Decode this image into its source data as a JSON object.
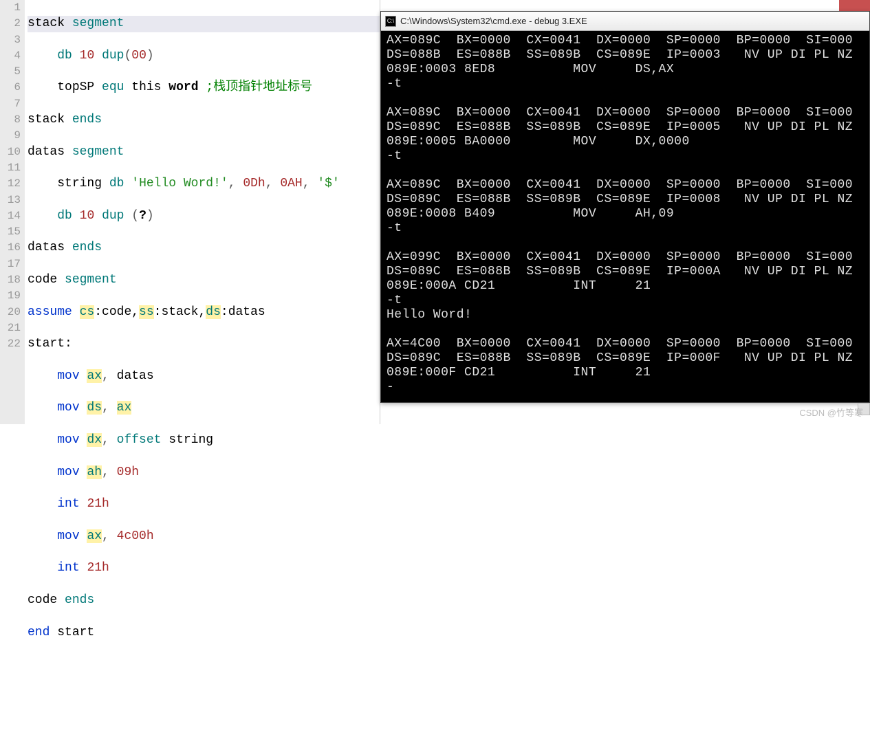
{
  "editor": {
    "line_numbers": [
      "1",
      "2",
      "3",
      "4",
      "5",
      "6",
      "7",
      "8",
      "9",
      "10",
      "11",
      "12",
      "13",
      "14",
      "15",
      "16",
      "17",
      "18",
      "19",
      "20",
      "21",
      "22"
    ],
    "tokens": {
      "stack": "stack",
      "segment": "segment",
      "db": "db",
      "ten": "10",
      "dup": "dup",
      "zero2": "00",
      "topSP": "topSP",
      "equ": "equ",
      "this": "this",
      "word": "word",
      "cmt1": ";栈顶指针地址标号",
      "ends": "ends",
      "datas": "datas",
      "string": "string",
      "hello": "'Hello Word!'",
      "odh": "0Dh",
      "oah": "0AH",
      "dollar": "'$'",
      "qmark": "?",
      "code": "code",
      "assume": "assume",
      "cs": "cs",
      "codel": ":code,",
      "ss": "ss",
      "stackl": ":stack,",
      "ds": "ds",
      "datasl": ":datas",
      "start": "start:",
      "mov": "mov",
      "ax": "ax",
      "dx": "dx",
      "ah": "ah",
      "offset": "offset",
      "int": "int",
      "h21": "21h",
      "h09": "09h",
      "h4c00": "4c00h",
      "end": "end",
      "startw": "start",
      "comma": ", "
    }
  },
  "console": {
    "title": "C:\\Windows\\System32\\cmd.exe - debug  3.EXE",
    "lines": [
      "AX=089C  BX=0000  CX=0041  DX=0000  SP=0000  BP=0000  SI=000",
      "DS=088B  ES=088B  SS=089B  CS=089E  IP=0003   NV UP DI PL NZ",
      "089E:0003 8ED8          MOV     DS,AX",
      "-t",
      "",
      "AX=089C  BX=0000  CX=0041  DX=0000  SP=0000  BP=0000  SI=000",
      "DS=089C  ES=088B  SS=089B  CS=089E  IP=0005   NV UP DI PL NZ",
      "089E:0005 BA0000        MOV     DX,0000",
      "-t",
      "",
      "AX=089C  BX=0000  CX=0041  DX=0000  SP=0000  BP=0000  SI=000",
      "DS=089C  ES=088B  SS=089B  CS=089E  IP=0008   NV UP DI PL NZ",
      "089E:0008 B409          MOV     AH,09",
      "-t",
      "",
      "AX=099C  BX=0000  CX=0041  DX=0000  SP=0000  BP=0000  SI=000",
      "DS=089C  ES=088B  SS=089B  CS=089E  IP=000A   NV UP DI PL NZ",
      "089E:000A CD21          INT     21",
      "-t",
      "Hello Word!",
      "",
      "AX=4C00  BX=0000  CX=0041  DX=0000  SP=0000  BP=0000  SI=000",
      "DS=089C  ES=088B  SS=089B  CS=089E  IP=000F   NV UP DI PL NZ",
      "089E:000F CD21          INT     21",
      "-"
    ]
  },
  "watermark": "CSDN @竹等寒"
}
